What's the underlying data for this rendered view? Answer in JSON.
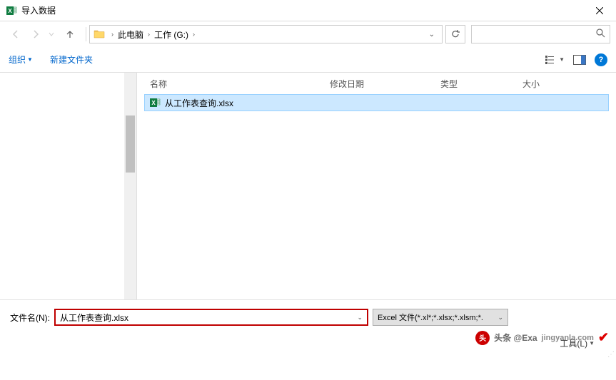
{
  "titlebar": {
    "title": "导入数据"
  },
  "breadcrumb": {
    "items": [
      "此电脑",
      "工作 (G:)"
    ]
  },
  "toolbar": {
    "organize": "组织",
    "newfolder": "新建文件夹"
  },
  "columns": {
    "name": "名称",
    "date": "修改日期",
    "type": "类型",
    "size": "大小"
  },
  "files": [
    {
      "name": "从工作表查询.xlsx"
    }
  ],
  "bottom": {
    "filename_label": "文件名(N):",
    "filename_value": "从工作表查询.xlsx",
    "filter": "Excel 文件(*.xl*;*.xlsx;*.xlsm;*.",
    "tools": "工具(L)"
  },
  "watermark": {
    "prefix": "头条 @Exa",
    "site": "jingyanla.com"
  }
}
